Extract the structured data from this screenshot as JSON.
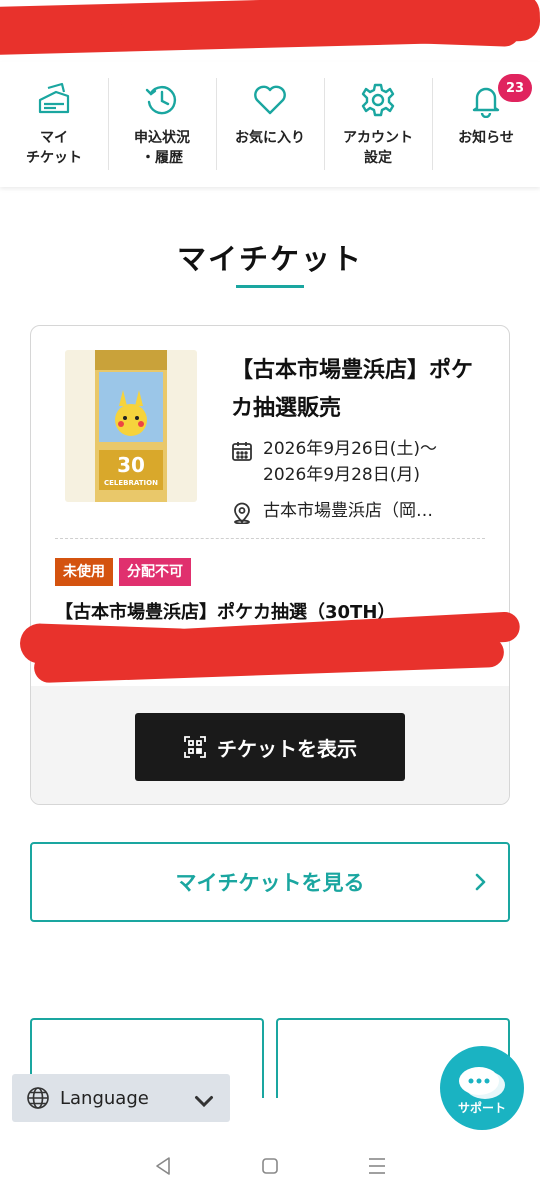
{
  "nav": {
    "items": [
      {
        "label": "マイ\nチケット",
        "icon": "ticket-icon"
      },
      {
        "label": "申込状況\n・履歴",
        "icon": "history-icon"
      },
      {
        "label": "お気に入り",
        "icon": "heart-icon"
      },
      {
        "label": "アカウント\n設定",
        "icon": "gear-icon"
      },
      {
        "label": "お知らせ",
        "icon": "bell-icon"
      }
    ],
    "notification_count": "23"
  },
  "page": {
    "title": "マイチケット"
  },
  "ticket": {
    "title": "【古本市場豊浜店】ポケカ抽選販売",
    "date_line1": "2026年9月26日(土)〜",
    "date_line2": "2026年9月28日(月)",
    "venue": "古本市場豊浜店（岡…",
    "tags": [
      "未使用",
      "分配不可"
    ],
    "ticket_name": "【古本市場豊浜店】ポケカ抽選（30TH）",
    "show_button": "チケットを表示",
    "image_text": "30th CELEBRATION"
  },
  "see_tickets_button": "マイチケットを見る",
  "language": {
    "label": "Language"
  },
  "support": {
    "label": "サポート"
  },
  "colors": {
    "accent": "#1aa6a0",
    "badge": "#e0245e",
    "tag_unused": "#d4530f",
    "tag_nodist": "#e0306e",
    "support": "#1ab3c2"
  }
}
